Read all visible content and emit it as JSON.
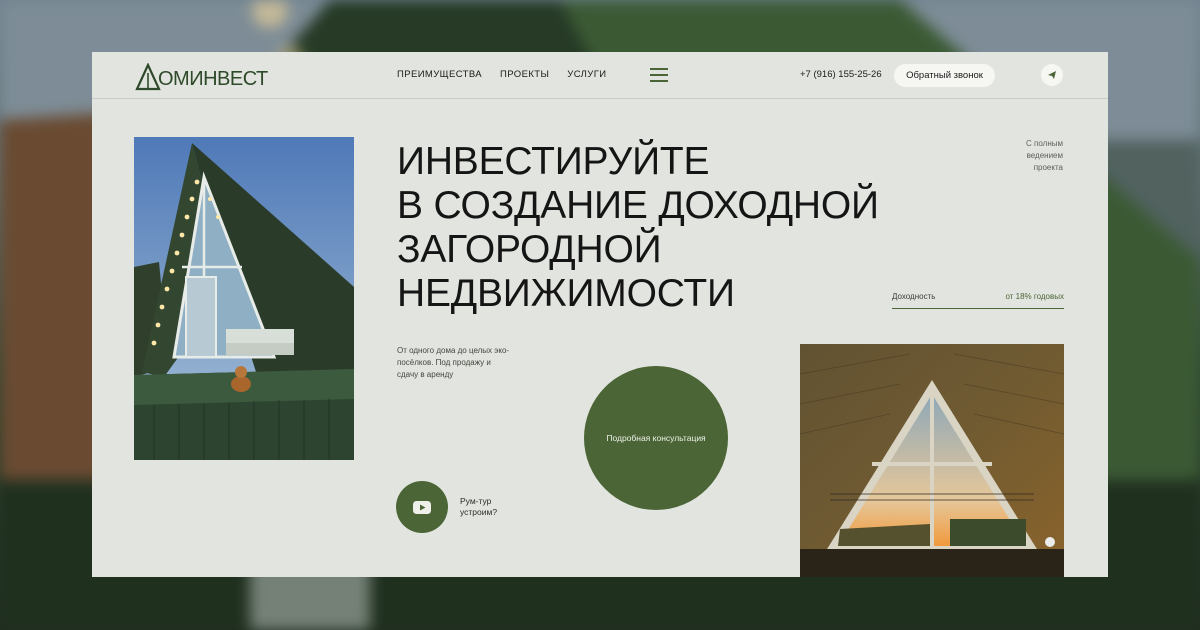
{
  "brand": {
    "name": "ОМИНВЕСТ",
    "accent_color": "#4b6536",
    "background_color": "#e2e5df"
  },
  "nav": {
    "items": [
      {
        "label": "ПРЕИМУЩЕСТВА"
      },
      {
        "label": "ПРОЕКТЫ"
      },
      {
        "label": "УСЛУГИ"
      }
    ],
    "menu_icon": "hamburger-menu-icon"
  },
  "contacts": {
    "phone": "+7 (916) 155-25-26",
    "callback_label": "Обратный звонок",
    "telegram_icon": "telegram-icon"
  },
  "hero": {
    "headline_lines": [
      "ИНВЕСТИРУЙТЕ",
      "В СОЗДАНИЕ ДОХОДНОЙ",
      "ЗАГОРОДНОЙ",
      "НЕДВИЖИМОСТИ"
    ],
    "side_note": "С полным ведением проекта",
    "yield_label": "Доходность",
    "yield_value": "от 18% годовых",
    "description": "От одного дома до целых эко-посёлков. Под продажу и сдачу в аренду",
    "consult_label": "Подробная консультация",
    "tour_label": "Рум-тур устроим?",
    "tour_icon": "youtube-icon"
  }
}
